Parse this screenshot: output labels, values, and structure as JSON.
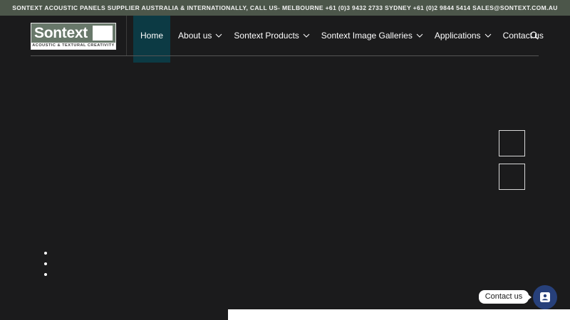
{
  "topbar": {
    "text": "SONTEXT ACOUSTIC PANELS SUPPLIER AUSTRALIA & INTERNATIONALLY, CALL US- MELBOURNE +61 (0)3 9432 2733 SYDNEY +61 (0)2 9844 5414 SALES@SONTEXT.COM.AU"
  },
  "logo": {
    "word": "Sontext",
    "tagline": "ACOUSTIC & TEXTURAL CREATIVITY"
  },
  "nav": {
    "items": [
      {
        "label": "Home",
        "active": true,
        "dropdown": false
      },
      {
        "label": "About us",
        "dropdown": true
      },
      {
        "label": "Sontext Products",
        "dropdown": true
      },
      {
        "label": "Sontext Image Galleries",
        "dropdown": true
      },
      {
        "label": "Applications",
        "dropdown": true
      },
      {
        "label": "Contact us",
        "dropdown": false
      }
    ],
    "search_icon": "search-icon",
    "active_color": "#0c3a44"
  },
  "slider": {
    "dot_count": 3
  },
  "chat": {
    "bubble_label": "Contact us",
    "fab_icon": "contact-card-icon",
    "fab_color": "#27407a"
  },
  "colors": {
    "background": "#1b1b1c",
    "topbar": "#4c564a"
  }
}
